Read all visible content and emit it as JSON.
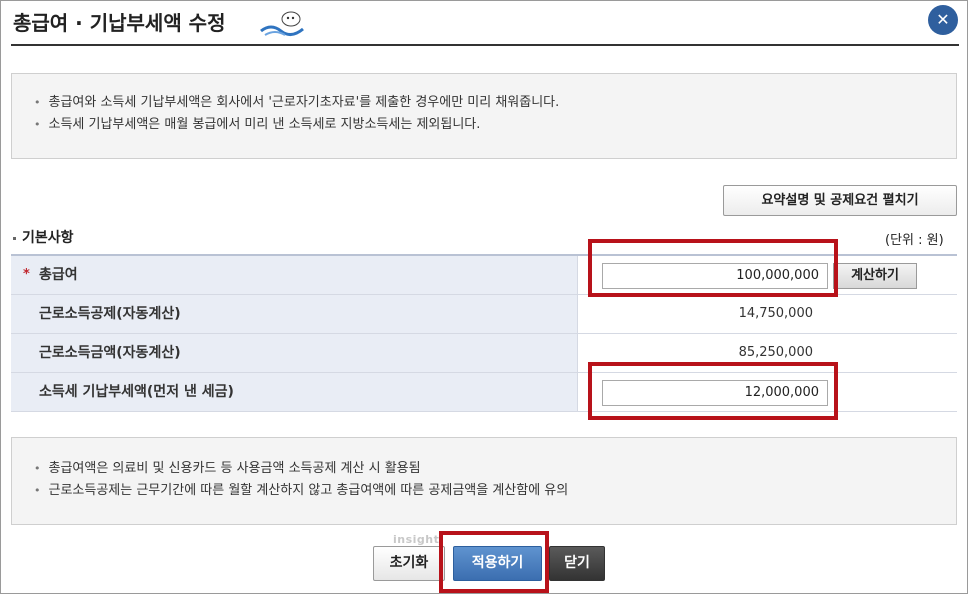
{
  "header": {
    "title": "총급여 · 기납부세액 수정",
    "close_label": "✕"
  },
  "notice_top": [
    "총급여와 소득세 기납부세액은 회사에서 '근로자기초자료'를 제출한 경우에만 미리 채워줍니다.",
    "소득세 기납부세액은 매월 봉급에서 미리 낸 소득세로 지방소득세는 제외됩니다."
  ],
  "summary_button": "요약설명 및 공제요건 펼치기",
  "section": {
    "title": "기본사항",
    "unit": "(단위 : 원)"
  },
  "form": {
    "gross_pay": {
      "required_mark": "*",
      "label": "총급여",
      "value": "100,000,000",
      "calc_button": "계산하기"
    },
    "earned_income_deduction": {
      "label": "근로소득공제(자동계산)",
      "value": "14,750,000"
    },
    "earned_income_amount": {
      "label": "근로소득금액(자동계산)",
      "value": "85,250,000"
    },
    "prepaid_tax": {
      "label": "소득세 기납부세액(먼저 낸 세금)",
      "value": "12,000,000"
    }
  },
  "notice_bottom": [
    "총급여액은 의료비 및 신용카드 등 사용금액 소득공제 계산 시 활용됨",
    "근로소득공제는 근무기간에 따른 월할 계산하지 않고 총급여액에 따른 공제금액을 계산함에 유의"
  ],
  "footer": {
    "reset": "초기화",
    "apply": "적용하기",
    "close": "닫기"
  },
  "watermark": "insight",
  "colors": {
    "accent": "#3b6eb0",
    "highlight": "#b8121a",
    "label_bg": "#e9edf5"
  }
}
